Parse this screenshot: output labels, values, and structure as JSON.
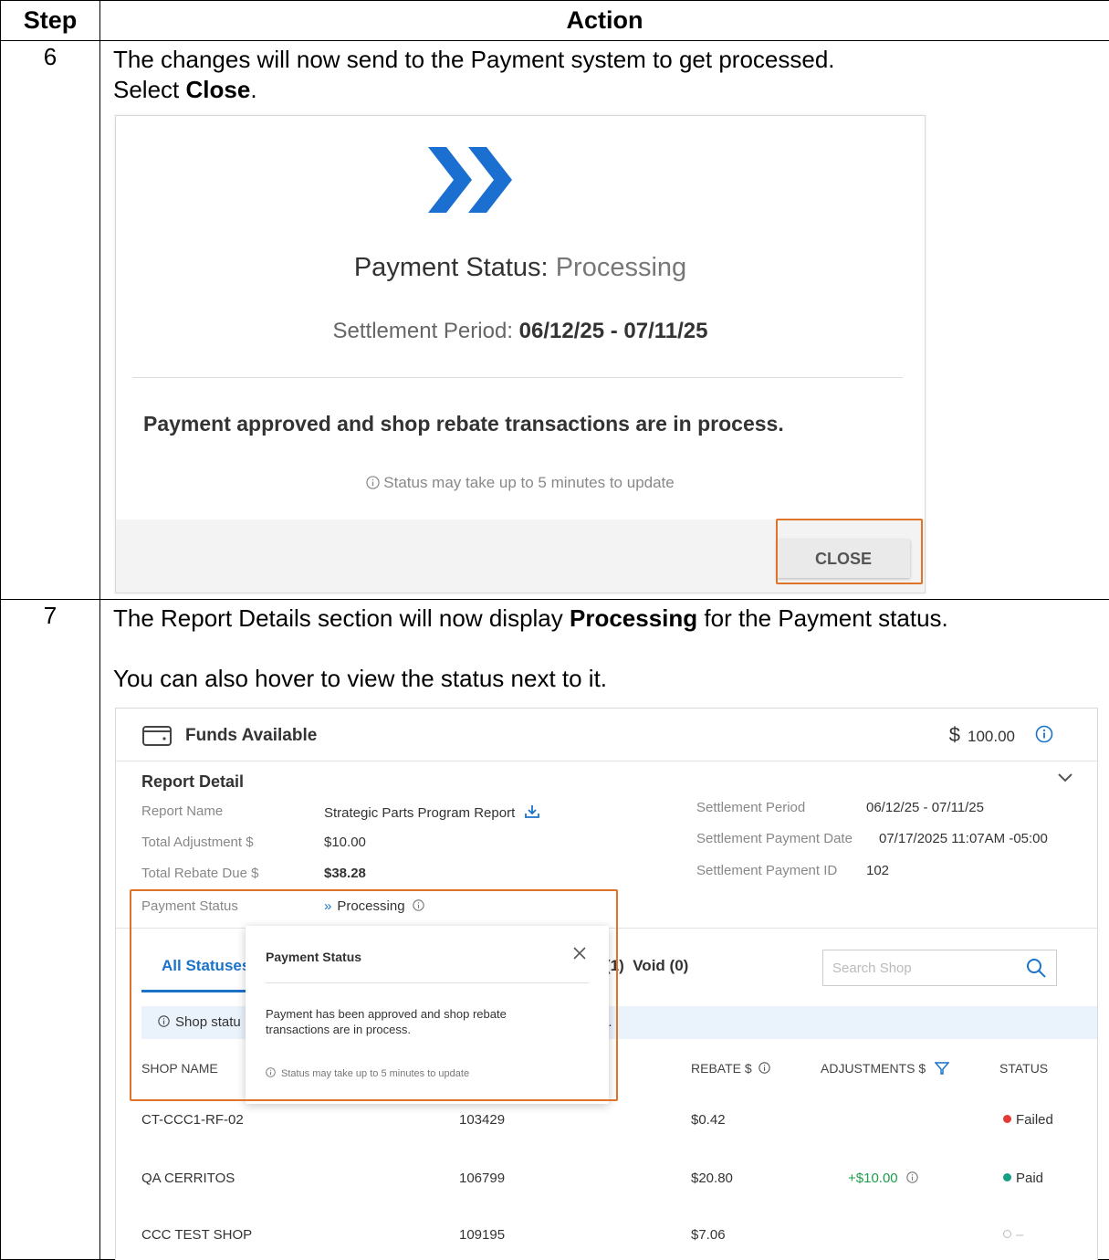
{
  "table": {
    "header_step": "Step",
    "header_action": "Action",
    "step6": {
      "number": "6",
      "line1": "The changes will now send to the Payment system to get processed.",
      "line2_prefix": "Select ",
      "line2_bold": "Close",
      "line2_suffix": "."
    },
    "step7": {
      "number": "7",
      "line1_prefix": "The Report Details section will now display ",
      "line1_bold": "Processing",
      "line1_suffix": " for the Payment status.",
      "line2": "You can also hover to view the status next to it."
    }
  },
  "dialog": {
    "status_label": "Payment Status:",
    "status_value": "Processing",
    "period_label": "Settlement Period:",
    "period_value": "06/12/25 - 07/11/25",
    "message": "Payment approved and shop rebate transactions are in process.",
    "note": "Status may take up to 5 minutes to update",
    "close_label": "CLOSE",
    "accent": "#1a6fd1",
    "highlight": "#e0732a"
  },
  "report": {
    "funds_label": "Funds Available",
    "funds_currency": "$",
    "funds_amount": "100.00",
    "detail_title": "Report Detail",
    "left": {
      "report_name_label": "Report Name",
      "report_name_value": "Strategic Parts Program Report",
      "total_adjustment_label": "Total Adjustment $",
      "total_adjustment_value": "$10.00",
      "total_rebate_label": "Total Rebate Due $",
      "total_rebate_value": "$38.28",
      "payment_status_label": "Payment Status",
      "payment_status_value": "Processing"
    },
    "right": {
      "settlement_period_label": "Settlement Period",
      "settlement_period_value": "06/12/25 - 07/11/25",
      "settlement_date_label": "Settlement Payment Date",
      "settlement_date_value": "07/17/2025 11:07AM -05:00",
      "settlement_id_label": "Settlement Payment ID",
      "settlement_id_value": "102"
    },
    "tabs": {
      "active": "All Statuses",
      "other_fragment": "(1)",
      "void": "Void (0)"
    },
    "search_placeholder": "Search Shop",
    "banner": "Shop statu",
    "banner_tail": "l.",
    "columns": {
      "shop_name": "SHOP NAME",
      "rebate": "REBATE $",
      "adjustments": "ADJUSTMENTS $",
      "status": "STATUS"
    },
    "rows": [
      {
        "name": "CT-CCC1-RF-02",
        "id": "103429",
        "rebate": "$0.42",
        "adjustment": "",
        "status": "Failed"
      },
      {
        "name": "QA CERRITOS",
        "id": "106799",
        "rebate": "$20.80",
        "adjustment": "+$10.00",
        "status": "Paid"
      },
      {
        "name": "CCC TEST SHOP",
        "id": "109195",
        "rebate": "$7.06",
        "adjustment": "",
        "status": "–"
      }
    ],
    "status_colors": {
      "failed": "#e53935",
      "paid": "#15a085",
      "none": "#bbbbbb"
    },
    "popover": {
      "title": "Payment Status",
      "body": "Payment has been approved and shop rebate transactions are in process.",
      "note": "Status may take up to 5 minutes to update"
    }
  }
}
